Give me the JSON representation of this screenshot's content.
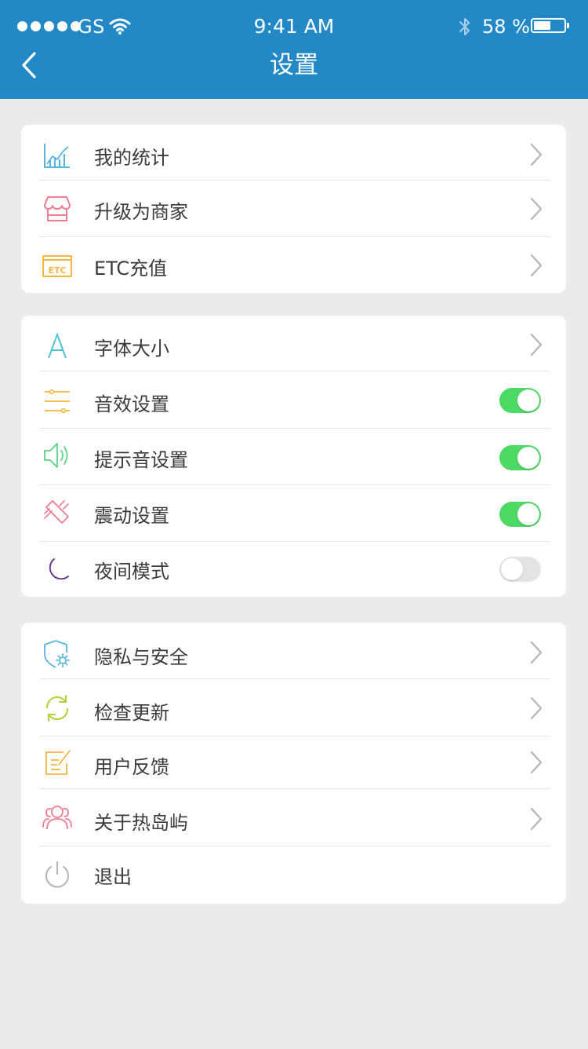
{
  "status_bar": {
    "carrier": "GS",
    "time": "9:41 AM",
    "battery": "58 %",
    "battery_level": 0.58
  },
  "nav": {
    "title": "设置"
  },
  "colors": {
    "header": "#2389c6",
    "toggle_on": "#4cd964",
    "toggle_off": "#e4e4e4",
    "background": "#ecebec"
  },
  "groups": [
    {
      "items": [
        {
          "label": "我的统计",
          "icon": "bar-chart-icon",
          "control": "chevron"
        },
        {
          "label": "升级为商家",
          "icon": "shop-icon",
          "control": "chevron"
        },
        {
          "label": "ETC充值",
          "icon": "etc-card-icon",
          "control": "chevron"
        }
      ]
    },
    {
      "items": [
        {
          "label": "字体大小",
          "icon": "font-icon",
          "control": "chevron"
        },
        {
          "label": "音效设置",
          "icon": "equalizer-icon",
          "control": "toggle",
          "on": true
        },
        {
          "label": "提示音设置",
          "icon": "speaker-icon",
          "control": "toggle",
          "on": true
        },
        {
          "label": "震动设置",
          "icon": "vibrate-icon",
          "control": "toggle",
          "on": true
        },
        {
          "label": "夜间模式",
          "icon": "moon-icon",
          "control": "toggle",
          "on": false
        }
      ]
    },
    {
      "items": [
        {
          "label": "隐私与安全",
          "icon": "shield-gear-icon",
          "control": "chevron"
        },
        {
          "label": "检查更新",
          "icon": "refresh-icon",
          "control": "chevron"
        },
        {
          "label": "用户反馈",
          "icon": "feedback-edit-icon",
          "control": "chevron"
        },
        {
          "label": "关于热岛屿",
          "icon": "users-icon",
          "control": "chevron"
        },
        {
          "label": "退出",
          "icon": "power-icon",
          "control": "none"
        }
      ]
    }
  ]
}
